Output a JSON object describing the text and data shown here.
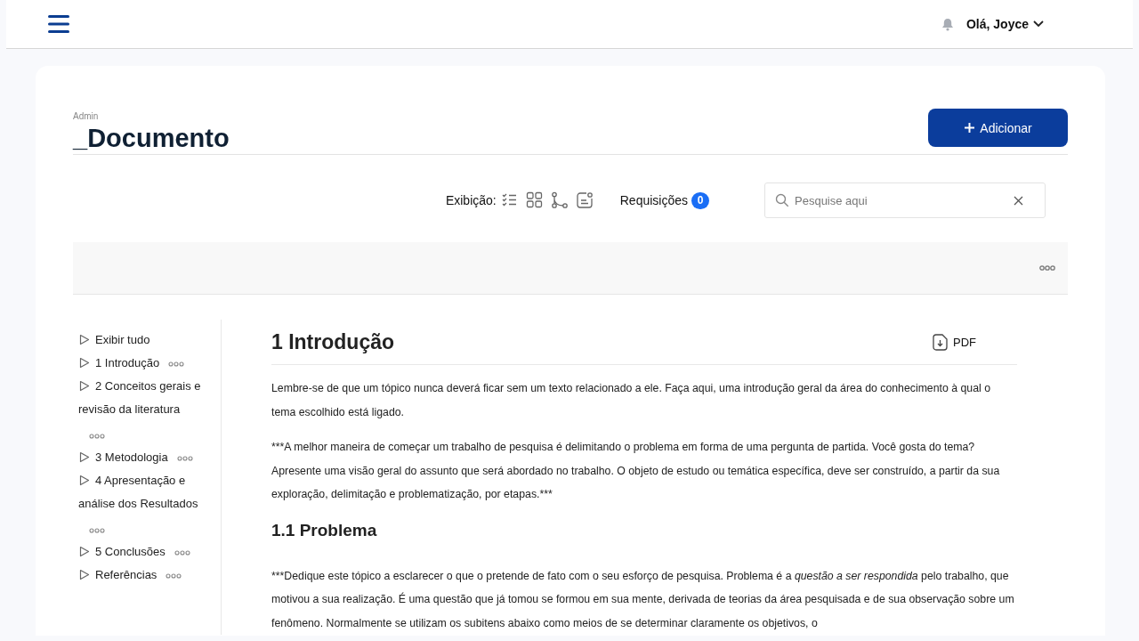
{
  "header": {
    "greeting": "Olá, Joyce"
  },
  "page": {
    "breadcrumb": "Admin",
    "title": "_Documento",
    "add_button": "Adicionar"
  },
  "toolbar": {
    "view_label": "Exibição:",
    "view_modes": [
      {
        "kind": "checklist"
      },
      {
        "kind": "grid"
      },
      {
        "kind": "branch"
      },
      {
        "kind": "note"
      }
    ],
    "requests_label": "Requisições",
    "requests_count": "0",
    "search": {
      "placeholder": "Pesquise aqui"
    }
  },
  "outline": [
    {
      "label": "Exibir tudo",
      "menu": false
    },
    {
      "label": "1 Introdução",
      "menu": true
    },
    {
      "label": "2 Conceitos gerais e revisão da literatura",
      "menu": true
    },
    {
      "label": "3 Metodologia",
      "menu": true
    },
    {
      "label": "4 Apresentação e análise dos Resultados",
      "menu": true
    },
    {
      "label": "5 Conclusões",
      "menu": true
    },
    {
      "label": "Referências",
      "menu": true
    }
  ],
  "document": {
    "title": "1 Introdução",
    "pdf_button": "PDF",
    "blocks": [
      {
        "kind": "paragraph",
        "runs": [
          {
            "text": "Lembre-se de que um tópico nunca deverá ficar sem um texto relacionado a ele. Faça aqui, uma introdução geral da área do conhecimento à qual o tema escolhido está ligado.",
            "italic": false
          }
        ]
      },
      {
        "kind": "paragraph",
        "runs": [
          {
            "text": "***A melhor maneira de começar um trabalho de pesquisa é delimitando o problema em forma de uma pergunta de partida. Você gosta do tema? Apresente uma visão geral do assunto que será abordado no trabalho. O objeto de estudo ou temática específica, deve ser construído, a partir da sua exploração, delimitação e problematização, por etapas.***",
            "italic": false
          }
        ]
      },
      {
        "kind": "heading",
        "runs": [
          {
            "text": "1.1 Problema",
            "italic": false
          }
        ]
      },
      {
        "kind": "paragraph",
        "runs": [
          {
            "text": "***Dedique este tópico a esclarecer o que o pretende de fato com o seu esforço de pesquisa. Problema é a ",
            "italic": false
          },
          {
            "text": "questão a ser respondida",
            "italic": true
          },
          {
            "text": " pelo trabalho, que motivou a sua realização. É uma questão que já tomou se formou em sua mente, derivada de teorias da área pesquisada e de sua observação sobre um fenômeno. Normalmente se utilizam os subitens abaixo como meios de se determinar claramente os objetivos, o",
            "italic": false
          }
        ]
      }
    ]
  }
}
